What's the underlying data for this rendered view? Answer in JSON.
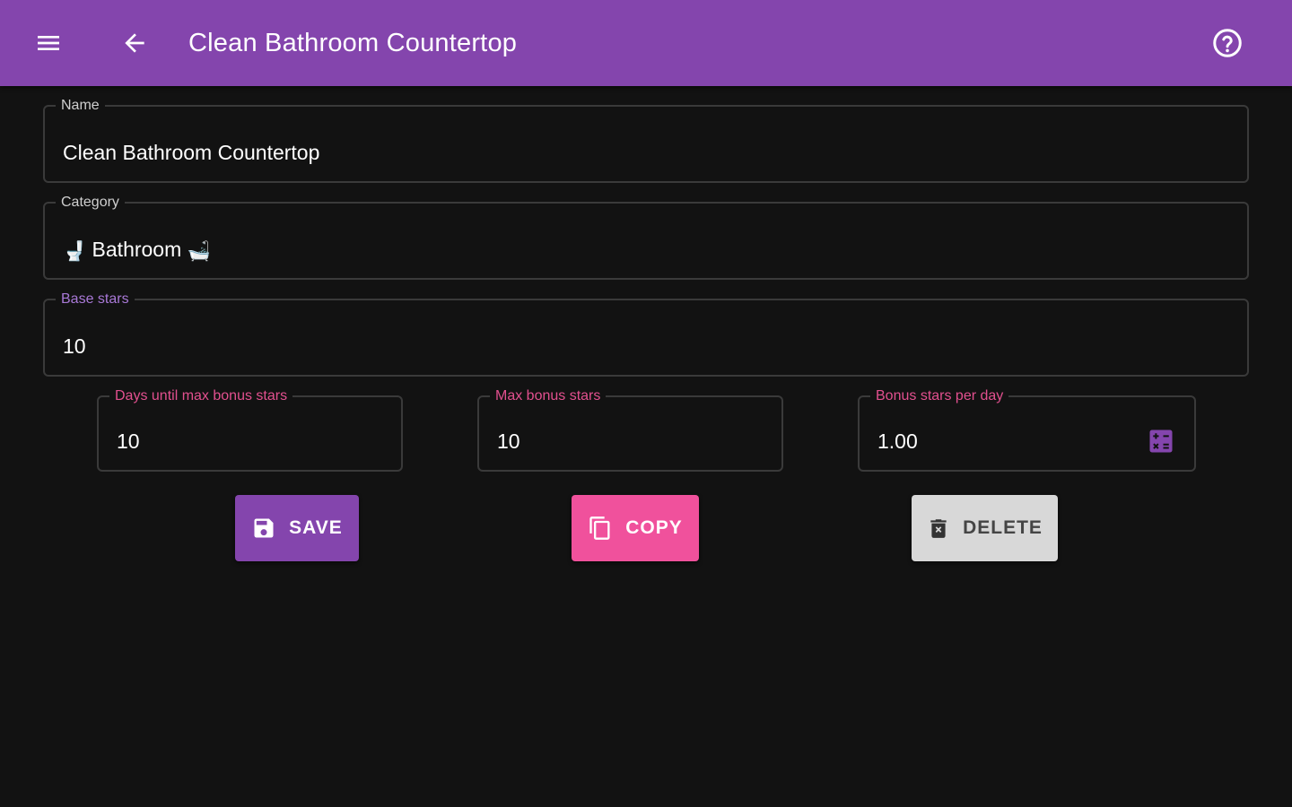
{
  "app_bar": {
    "title": "Clean Bathroom Countertop",
    "icons": [
      "menu-icon",
      "back-arrow-icon",
      "help-icon"
    ],
    "color": "#8445ad"
  },
  "form": {
    "name": {
      "label": "Name",
      "value": "Clean Bathroom Countertop"
    },
    "category": {
      "label": "Category",
      "value": "Bathroom",
      "icons": [
        "toilet-icon",
        "bathtub-icon"
      ]
    },
    "base_stars": {
      "label": "Base stars",
      "value": "10"
    },
    "days_until_max_bonus": {
      "label": "Days until max bonus stars",
      "value": "10"
    },
    "max_bonus_stars": {
      "label": "Max bonus stars",
      "value": "10"
    },
    "bonus_stars_per_day": {
      "label": "Bonus stars per day",
      "value": "1.00",
      "icon": "calculator-icon"
    }
  },
  "actions": {
    "save": {
      "label": "SAVE",
      "icon": "save-icon",
      "color": "#8445ad"
    },
    "copy": {
      "label": "COPY",
      "icon": "copy-icon",
      "color": "#f0519c"
    },
    "delete": {
      "label": "DELETE",
      "icon": "delete-icon",
      "color": "#d8d8d8"
    }
  },
  "colors": {
    "background": "#121212",
    "label_purple": "#a878d6",
    "label_pink": "#e2508f"
  }
}
